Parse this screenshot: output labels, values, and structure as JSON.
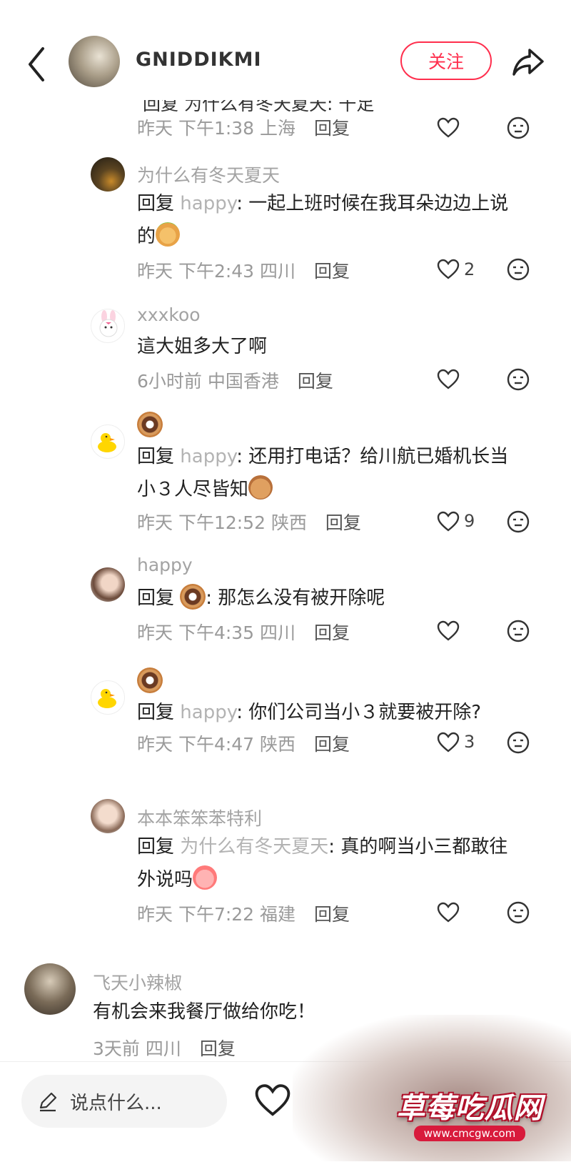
{
  "header": {
    "username": "GNIDDIKMI",
    "follow_label": "关注"
  },
  "top_comment": {
    "cut_text": "回复 为什么有冬天夏天: 千足",
    "time": "昨天 下午1:38",
    "location": "上海",
    "reply_label": "回复"
  },
  "comments": [
    {
      "username": "为什么有冬天夏天",
      "reply_prefix": "回复",
      "mention": "happy",
      "text": ": 一起上班时候在我耳朵边边上说",
      "text2": "的",
      "time": "昨天 下午2:43",
      "location": "四川",
      "reply_label": "回复",
      "likes": "2"
    },
    {
      "username": "xxxkoo",
      "text": "這大姐多大了啊",
      "time": "6小时前",
      "location": "中国香港",
      "reply_label": "回复"
    },
    {
      "username": "",
      "reply_prefix": "回复",
      "mention": "happy",
      "text": ": 还用打电话？给川航已婚机长当",
      "text2": "小３人尽皆知",
      "time": "昨天 下午12:52",
      "location": "陕西",
      "reply_label": "回复",
      "likes": "9"
    },
    {
      "username": "happy",
      "reply_prefix": "回复",
      "text": ": 那怎么没有被开除呢",
      "time": "昨天 下午4:35",
      "location": "四川",
      "reply_label": "回复"
    },
    {
      "username": "",
      "reply_prefix": "回复",
      "mention": "happy",
      "text": ": 你们公司当小３就要被开除?",
      "time": "昨天 下午4:47",
      "location": "陕西",
      "reply_label": "回复",
      "likes": "3"
    },
    {
      "username": "本本笨笨苯特利",
      "reply_prefix": "回复",
      "mention": "为什么有冬天夏天",
      "text": ": 真的啊当小三都敢往",
      "text2": "外说吗",
      "time": "昨天 下午7:22",
      "location": "福建",
      "reply_label": "回复"
    }
  ],
  "main_comment": {
    "username": "飞天小辣椒",
    "text": "有机会来我餐厅做给你吃！",
    "time": "3天前",
    "location": "四川",
    "reply_label": "回复"
  },
  "bottom_bar": {
    "placeholder": "说点什么..."
  },
  "watermark": {
    "text": "草莓吃瓜网",
    "url": "www.cmcgw.com"
  },
  "colors": {
    "accent": "#ff2e4d",
    "muted_text": "#9a9a9a",
    "mention": "#b3b3b3"
  }
}
